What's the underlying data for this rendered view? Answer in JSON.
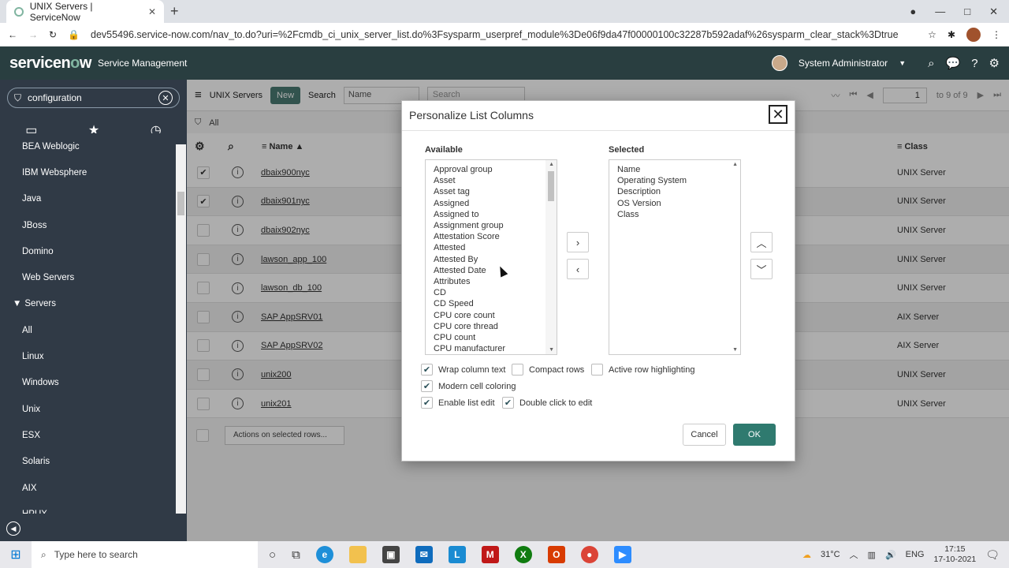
{
  "browser": {
    "tab_title": "UNIX Servers | ServiceNow",
    "url": "dev55496.service-now.com/nav_to.do?uri=%2Fcmdb_ci_unix_server_list.do%3Fsysparm_userpref_module%3De06f9da47f00000100c32287b592adaf%26sysparm_clear_stack%3Dtrue"
  },
  "header": {
    "logo_prefix": "servicen",
    "logo_o": "o",
    "logo_suffix": "w",
    "subtitle": "Service Management",
    "user": "System Administrator"
  },
  "sidebar": {
    "filter_value": "configuration",
    "items": [
      {
        "label": "BEA Weblogic",
        "section": false
      },
      {
        "label": "IBM Websphere",
        "section": false
      },
      {
        "label": "Java",
        "section": false
      },
      {
        "label": "JBoss",
        "section": false
      },
      {
        "label": "Domino",
        "section": false
      },
      {
        "label": "Web Servers",
        "section": false
      },
      {
        "label": "Servers",
        "section": true
      },
      {
        "label": "All",
        "section": false
      },
      {
        "label": "Linux",
        "section": false
      },
      {
        "label": "Windows",
        "section": false
      },
      {
        "label": "Unix",
        "section": false
      },
      {
        "label": "ESX",
        "section": false
      },
      {
        "label": "Solaris",
        "section": false
      },
      {
        "label": "AIX",
        "section": false
      },
      {
        "label": "HPUX",
        "section": false
      }
    ]
  },
  "list": {
    "title": "UNIX Servers",
    "new_label": "New",
    "search_label": "Search",
    "search_field": "Name",
    "search_placeholder": "Search",
    "page_value": "1",
    "range_text": "to 9 of 9",
    "filter_all": "All",
    "col_name": "Name",
    "col_class": "Class",
    "actions_label": "Actions on selected rows...",
    "rows": [
      {
        "name": "dbaix900nyc",
        "class": "UNIX Server",
        "checked": true
      },
      {
        "name": "dbaix901nyc",
        "class": "UNIX Server",
        "checked": true
      },
      {
        "name": "dbaix902nyc",
        "class": "UNIX Server",
        "checked": false
      },
      {
        "name": "lawson_app_100",
        "class": "UNIX Server",
        "checked": false
      },
      {
        "name": "lawson_db_100",
        "class": "UNIX Server",
        "checked": false
      },
      {
        "name": "SAP AppSRV01",
        "class": "AIX Server",
        "checked": false
      },
      {
        "name": "SAP AppSRV02",
        "class": "AIX Server",
        "checked": false
      },
      {
        "name": "unix200",
        "class": "UNIX Server",
        "checked": false
      },
      {
        "name": "unix201",
        "class": "UNIX Server",
        "checked": false
      }
    ]
  },
  "modal": {
    "title": "Personalize List Columns",
    "available_label": "Available",
    "selected_label": "Selected",
    "available": [
      "Approval group",
      "Asset",
      "Asset tag",
      "Assigned",
      "Assigned to",
      "Assignment group",
      "Attestation Score",
      "Attested",
      "Attested By",
      "Attested Date",
      "Attributes",
      "CD",
      "CD Speed",
      "CPU core count",
      "CPU core thread",
      "CPU count",
      "CPU manufacturer"
    ],
    "selected": [
      "Name",
      "Operating System",
      "Description",
      "OS Version",
      "Class"
    ],
    "wrap_label": "Wrap column text",
    "compact_label": "Compact rows",
    "active_row_label": "Active row highlighting",
    "modern_label": "Modern cell coloring",
    "enable_edit_label": "Enable list edit",
    "double_click_label": "Double click to edit",
    "cancel_label": "Cancel",
    "ok_label": "OK"
  },
  "taskbar": {
    "search_placeholder": "Type here to search",
    "temperature": "31°C",
    "language": "ENG",
    "time": "17:15",
    "date": "17-10-2021"
  }
}
